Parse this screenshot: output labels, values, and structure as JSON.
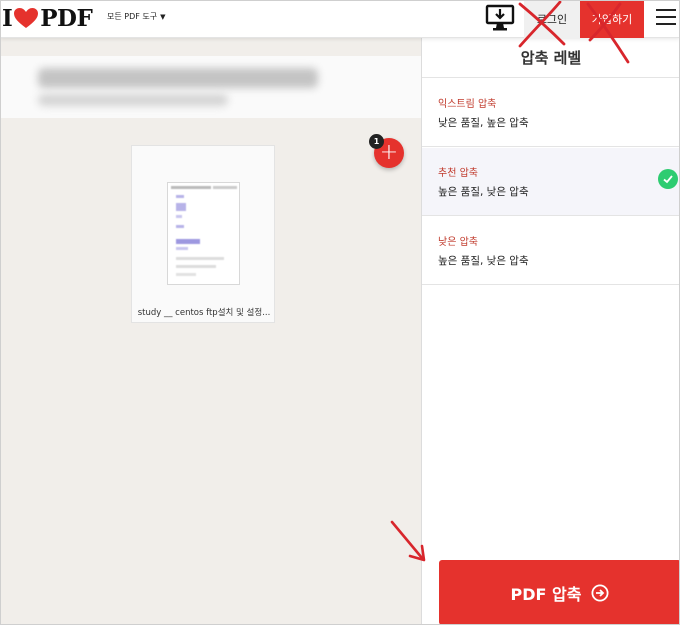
{
  "brand": {
    "logo_prefix": "I",
    "logo_suffix": "PDF",
    "accent": "#e5322d"
  },
  "header": {
    "tools_menu": "모든 PDF 도구",
    "login": "로그인",
    "signup": "가입하기",
    "desktop_icon": "desktop-download-icon",
    "menu_icon": "hamburger-icon"
  },
  "workspace": {
    "file": {
      "name": "study __ centos ftp설치 및 설정..."
    },
    "file_count": "1",
    "add_icon": "plus-icon"
  },
  "sidebar": {
    "title": "압축 레벨",
    "options": [
      {
        "name": "익스트림 압축",
        "desc": "낮은 품질, 높은 압축",
        "selected": false
      },
      {
        "name": "추천 압축",
        "desc": "높은 품질, 낮은 압축",
        "selected": true
      },
      {
        "name": "낮은 압축",
        "desc": "높은 품질, 낮은 압축",
        "selected": false
      }
    ],
    "action": "PDF 압축",
    "check_color": "#2ecc71"
  }
}
